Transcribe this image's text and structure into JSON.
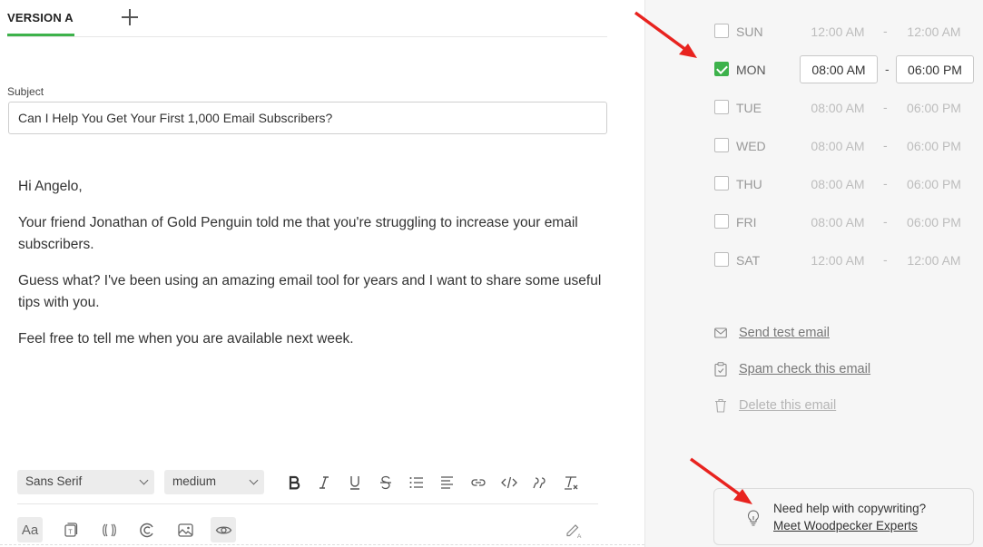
{
  "tabs": {
    "active": "VERSION A",
    "add_icon": "plus-icon"
  },
  "subject": {
    "label": "Subject",
    "value": "Can I Help You Get Your First 1,000 Email Subscribers?"
  },
  "body": {
    "greeting": "Hi Angelo,",
    "p1": "Your friend Jonathan of Gold Penguin told me that you're struggling to increase your email subscribers.",
    "p2": "Guess what? I've been using an amazing email tool for years and I want to share some useful tips with you.",
    "p3": "Feel free to tell me when you are available next week."
  },
  "toolbar": {
    "font_family": "Sans Serif",
    "font_size": "medium",
    "icons": [
      "bold-icon",
      "italic-icon",
      "underline-icon",
      "strikethrough-icon",
      "list-icon",
      "align-icon",
      "link-icon",
      "code-icon",
      "quote-icon",
      "clear-format-icon"
    ]
  },
  "toolbar2": {
    "text_style": "Aa",
    "icons": [
      "text-style-icon",
      "template-icon",
      "variable-icon",
      "spintax-icon",
      "image-icon",
      "preview-eye-icon",
      "ai-pen-icon"
    ]
  },
  "schedule": {
    "separator": "-",
    "days": [
      {
        "name": "SUN",
        "checked": false,
        "start": "12:00 AM",
        "end": "12:00 AM"
      },
      {
        "name": "MON",
        "checked": true,
        "start": "08:00 AM",
        "end": "06:00 PM"
      },
      {
        "name": "TUE",
        "checked": false,
        "start": "08:00 AM",
        "end": "06:00 PM"
      },
      {
        "name": "WED",
        "checked": false,
        "start": "08:00 AM",
        "end": "06:00 PM"
      },
      {
        "name": "THU",
        "checked": false,
        "start": "08:00 AM",
        "end": "06:00 PM"
      },
      {
        "name": "FRI",
        "checked": false,
        "start": "08:00 AM",
        "end": "06:00 PM"
      },
      {
        "name": "SAT",
        "checked": false,
        "start": "12:00 AM",
        "end": "12:00 AM"
      }
    ]
  },
  "actions": {
    "send_test": "Send test email",
    "spam_check": "Spam check this email",
    "delete": "Delete this email"
  },
  "help": {
    "question": "Need help with copywriting?",
    "link": "Meet Woodpecker Experts"
  },
  "colors": {
    "accent": "#3db24b",
    "arrow": "#e8231f"
  }
}
